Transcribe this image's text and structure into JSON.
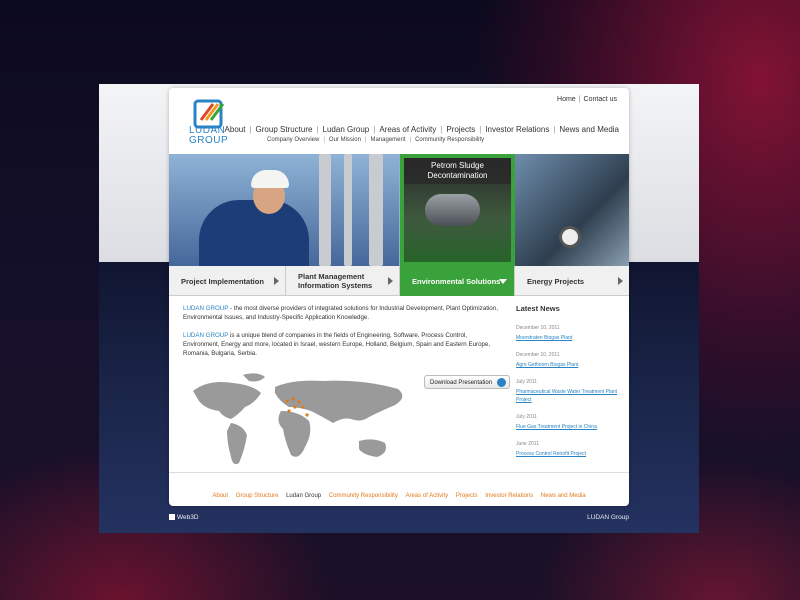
{
  "logo": {
    "line1": "LUDAN",
    "line2": "GROUP"
  },
  "toplinks": [
    "Home",
    "Contact us"
  ],
  "mainnav": [
    "About",
    "Group Structure",
    "Ludan Group",
    "Areas of Activity",
    "Projects",
    "Investor Relations",
    "News and Media"
  ],
  "subnav": [
    "Company Overview",
    "Our Mission",
    "Management",
    "Community Responsibility"
  ],
  "hero": {
    "caption": "Petrom Sludge Decontamination"
  },
  "tabs": [
    "Project Implementation",
    "Plant Management Information Systems",
    "Environmental Solutions",
    "Energy Projects"
  ],
  "active_tab": 2,
  "content": {
    "p1_brand": "LUDAN GROUP",
    "p1_text": " - the most diverse providers of integrated solutions for Industrial Development, Plant Optimization, Environmental Issues, and Industry-Specific Application Knowledge.",
    "p2_brand": "LUDAN GROUP",
    "p2_text": " is a unique blend of companies in the fields of Engineering, Software, Process Control, Environment, Energy and more, located in Israel, western Europe, Holland, Belgium, Spain and Eastern Europe, Romania, Bulgaria, Serbia."
  },
  "download_button": "Download Presentation",
  "news": {
    "title": "Latest News",
    "items": [
      {
        "date": "December 10, 2011",
        "title": "Moerstraten Biogas Plant"
      },
      {
        "date": "December 10, 2011",
        "title": "Agro Gethoorn Biogas Plant"
      },
      {
        "date": "July 2011",
        "title": "Pharmaceutical Waste Water Treatment Plant Project"
      },
      {
        "date": "July 2011",
        "title": "Flue Gas Treatment Project in China"
      },
      {
        "date": "June 2011",
        "title": "Process Control Retrofit Project"
      }
    ]
  },
  "footer": [
    "About",
    "Group Structure",
    "Ludan Group",
    "Community Responsibility",
    "Areas of Activity",
    "Projects",
    "Investor Relations",
    "News and Media"
  ],
  "footer_current": 2,
  "credit": "Web3D",
  "brand": "LUDAN Group",
  "colors": {
    "accent_blue": "#2a83c2",
    "active_green": "#3aa23a",
    "footer_orange": "#e07a1e"
  }
}
